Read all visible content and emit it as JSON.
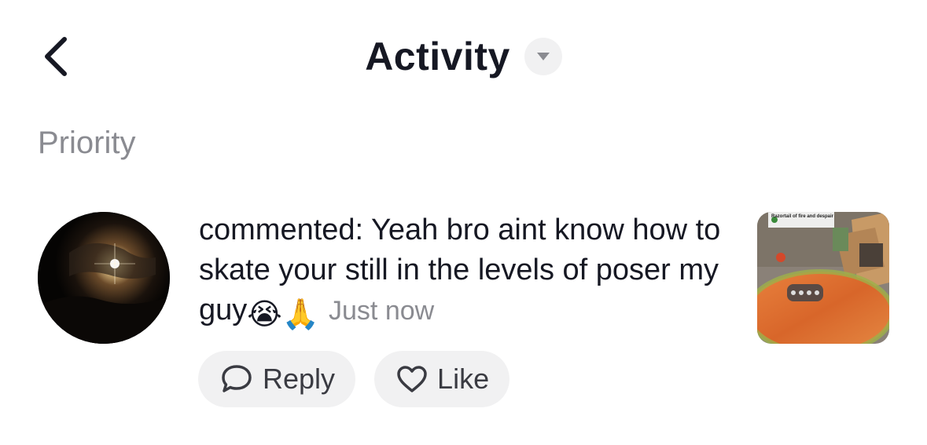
{
  "header": {
    "title": "Activity"
  },
  "section": {
    "label": "Priority"
  },
  "notification": {
    "text": "commented: Yeah bro aint know how to skate your still in the levels of poser my guy",
    "emojis": [
      "😭",
      "🙏"
    ],
    "timestamp": "Just now",
    "thumbnail_caption": "Razortail of fire and despair"
  },
  "actions": {
    "reply_label": "Reply",
    "like_label": "Like"
  },
  "icons": {
    "back": "chevron-left-icon",
    "dropdown": "triangle-down-icon",
    "reply": "speech-bubble-icon",
    "like": "heart-outline-icon"
  }
}
